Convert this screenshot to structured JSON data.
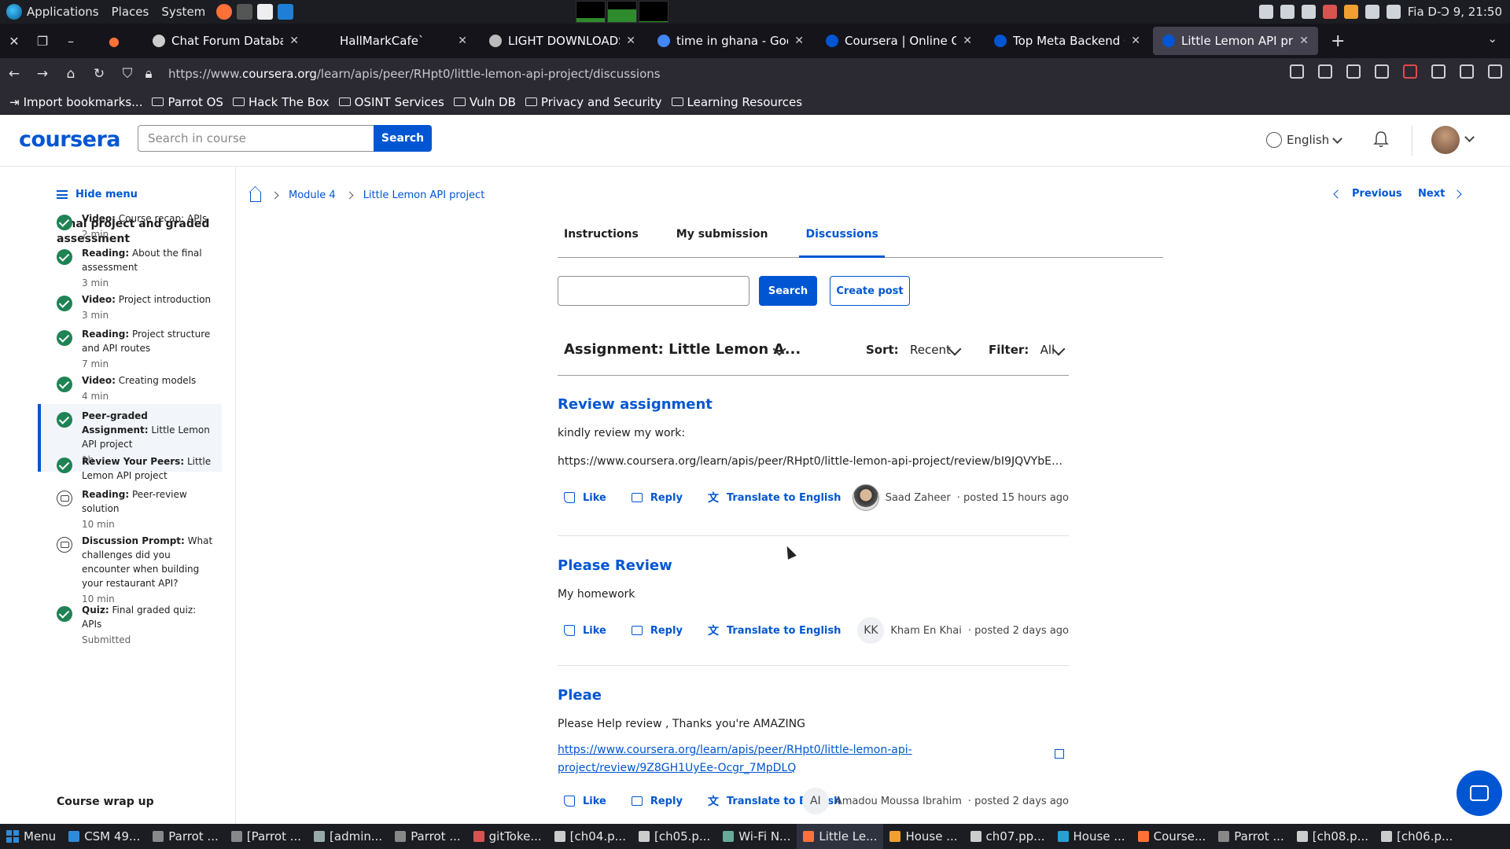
{
  "os_bar": {
    "menus": [
      "Applications",
      "Places",
      "System"
    ],
    "clock": "Fia D-Ɔ 9, 21:50",
    "graphs": [
      0.2,
      0.6,
      0.05
    ]
  },
  "browser": {
    "tabs": [
      {
        "title": "Chat Forum Database De",
        "favicon": "forum-icon",
        "active": false
      },
      {
        "title": "HallMarkCafe`",
        "favicon": "none",
        "active": false
      },
      {
        "title": "LIGHT DOWNLOADS: Kill",
        "favicon": "download-icon",
        "active": false
      },
      {
        "title": "time in ghana - Google Se",
        "favicon": "google-icon",
        "active": false
      },
      {
        "title": "Coursera | Online Course",
        "favicon": "coursera-icon",
        "active": false
      },
      {
        "title": "Top Meta Backend Course",
        "favicon": "coursera-icon",
        "active": false
      },
      {
        "title": "Little Lemon API project |",
        "favicon": "coursera-icon",
        "active": true
      }
    ],
    "url_prefix": "https://www.",
    "url_domain": "coursera.org",
    "url_path": "/learn/apis/peer/RHpt0/little-lemon-api-project/discussions",
    "bookmarks": [
      "Import bookmarks...",
      "Parrot OS",
      "Hack The Box",
      "OSINT Services",
      "Vuln DB",
      "Privacy and Security",
      "Learning Resources"
    ]
  },
  "header": {
    "logo": "coursera",
    "search_placeholder": "Search in course",
    "search_button": "Search",
    "language": "English"
  },
  "sidebar": {
    "hide_menu": "Hide menu",
    "section_title": "Final project and graded assessment",
    "items": [
      {
        "type": "Video:",
        "title": "Course recap: APIs",
        "duration": "2 min",
        "status": "done"
      },
      {
        "type": "Reading:",
        "title": "About the final assessment",
        "duration": "3 min",
        "status": "done"
      },
      {
        "type": "Video:",
        "title": "Project introduction",
        "duration": "3 min",
        "status": "done"
      },
      {
        "type": "Reading:",
        "title": "Project structure and API routes",
        "duration": "7 min",
        "status": "done"
      },
      {
        "type": "Video:",
        "title": "Creating models",
        "duration": "4 min",
        "status": "done"
      },
      {
        "type": "Peer-graded Assignment:",
        "title": "Little Lemon API project",
        "duration": "1h",
        "status": "done"
      },
      {
        "type": "Review Your Peers:",
        "title": "Little Lemon API project",
        "duration": "",
        "status": "done"
      },
      {
        "type": "Reading:",
        "title": "Peer-review solution",
        "duration": "10 min",
        "status": "todo"
      },
      {
        "type": "Discussion Prompt:",
        "title": "What challenges did you encounter when building your restaurant API?",
        "duration": "10 min",
        "status": "todo"
      },
      {
        "type": "Quiz:",
        "title": "Final graded quiz: APIs",
        "duration": "Submitted",
        "status": "done"
      }
    ],
    "next_section": "Course wrap up"
  },
  "breadcrumb": [
    "Module 4",
    "Little Lemon API project"
  ],
  "nav": {
    "previous": "Previous",
    "next": "Next"
  },
  "tabs": [
    "Instructions",
    "My submission",
    "Discussions"
  ],
  "discussion": {
    "search_button": "Search",
    "create_button": "Create post",
    "assignment_title": "Assignment: Little Lemon A...",
    "sort_label": "Sort:",
    "sort_value": "Recent",
    "filter_label": "Filter:",
    "filter_value": "All",
    "actions": {
      "like": "Like",
      "reply": "Reply",
      "translate": "Translate to English"
    },
    "posts": [
      {
        "title": "Review assignment",
        "body": "kindly review my work:",
        "link": "https://www.coursera.org/learn/apis/peer/RHpt0/little-lemon-api-project/review/bI9JQVYbEe-...",
        "author": "Saad Zaheer",
        "initials": "",
        "posted": "· posted 15 hours ago"
      },
      {
        "title": "Please Review",
        "body": "My homework",
        "link": "",
        "author": "Kham En Khai",
        "initials": "KK",
        "posted": "· posted 2 days ago"
      },
      {
        "title": "Pleae",
        "body": "Please Help review , Thanks you're AMAZING",
        "link": "https://www.coursera.org/learn/apis/peer/RHpt0/little-lemon-api-project/review/9Z8GH1UyEe-Ocgr_7MpDLQ",
        "author": "Amadou Moussa Ibrahim",
        "initials": "AI",
        "posted": "· posted 2 days ago"
      }
    ]
  },
  "taskbar": {
    "menu": "Menu",
    "items": [
      "CSM 49...",
      "Parrot ...",
      "[Parrot ...",
      "[admin...",
      "Parrot ...",
      "gitToke...",
      "[ch04.p...",
      "[ch05.p...",
      "Wi-Fi N...",
      "Little Le...",
      "House ...",
      "ch07.pp...",
      "House ...",
      "Course...",
      "Parrot ...",
      "[ch08.p...",
      "[ch06.p..."
    ],
    "active_index": 9
  }
}
